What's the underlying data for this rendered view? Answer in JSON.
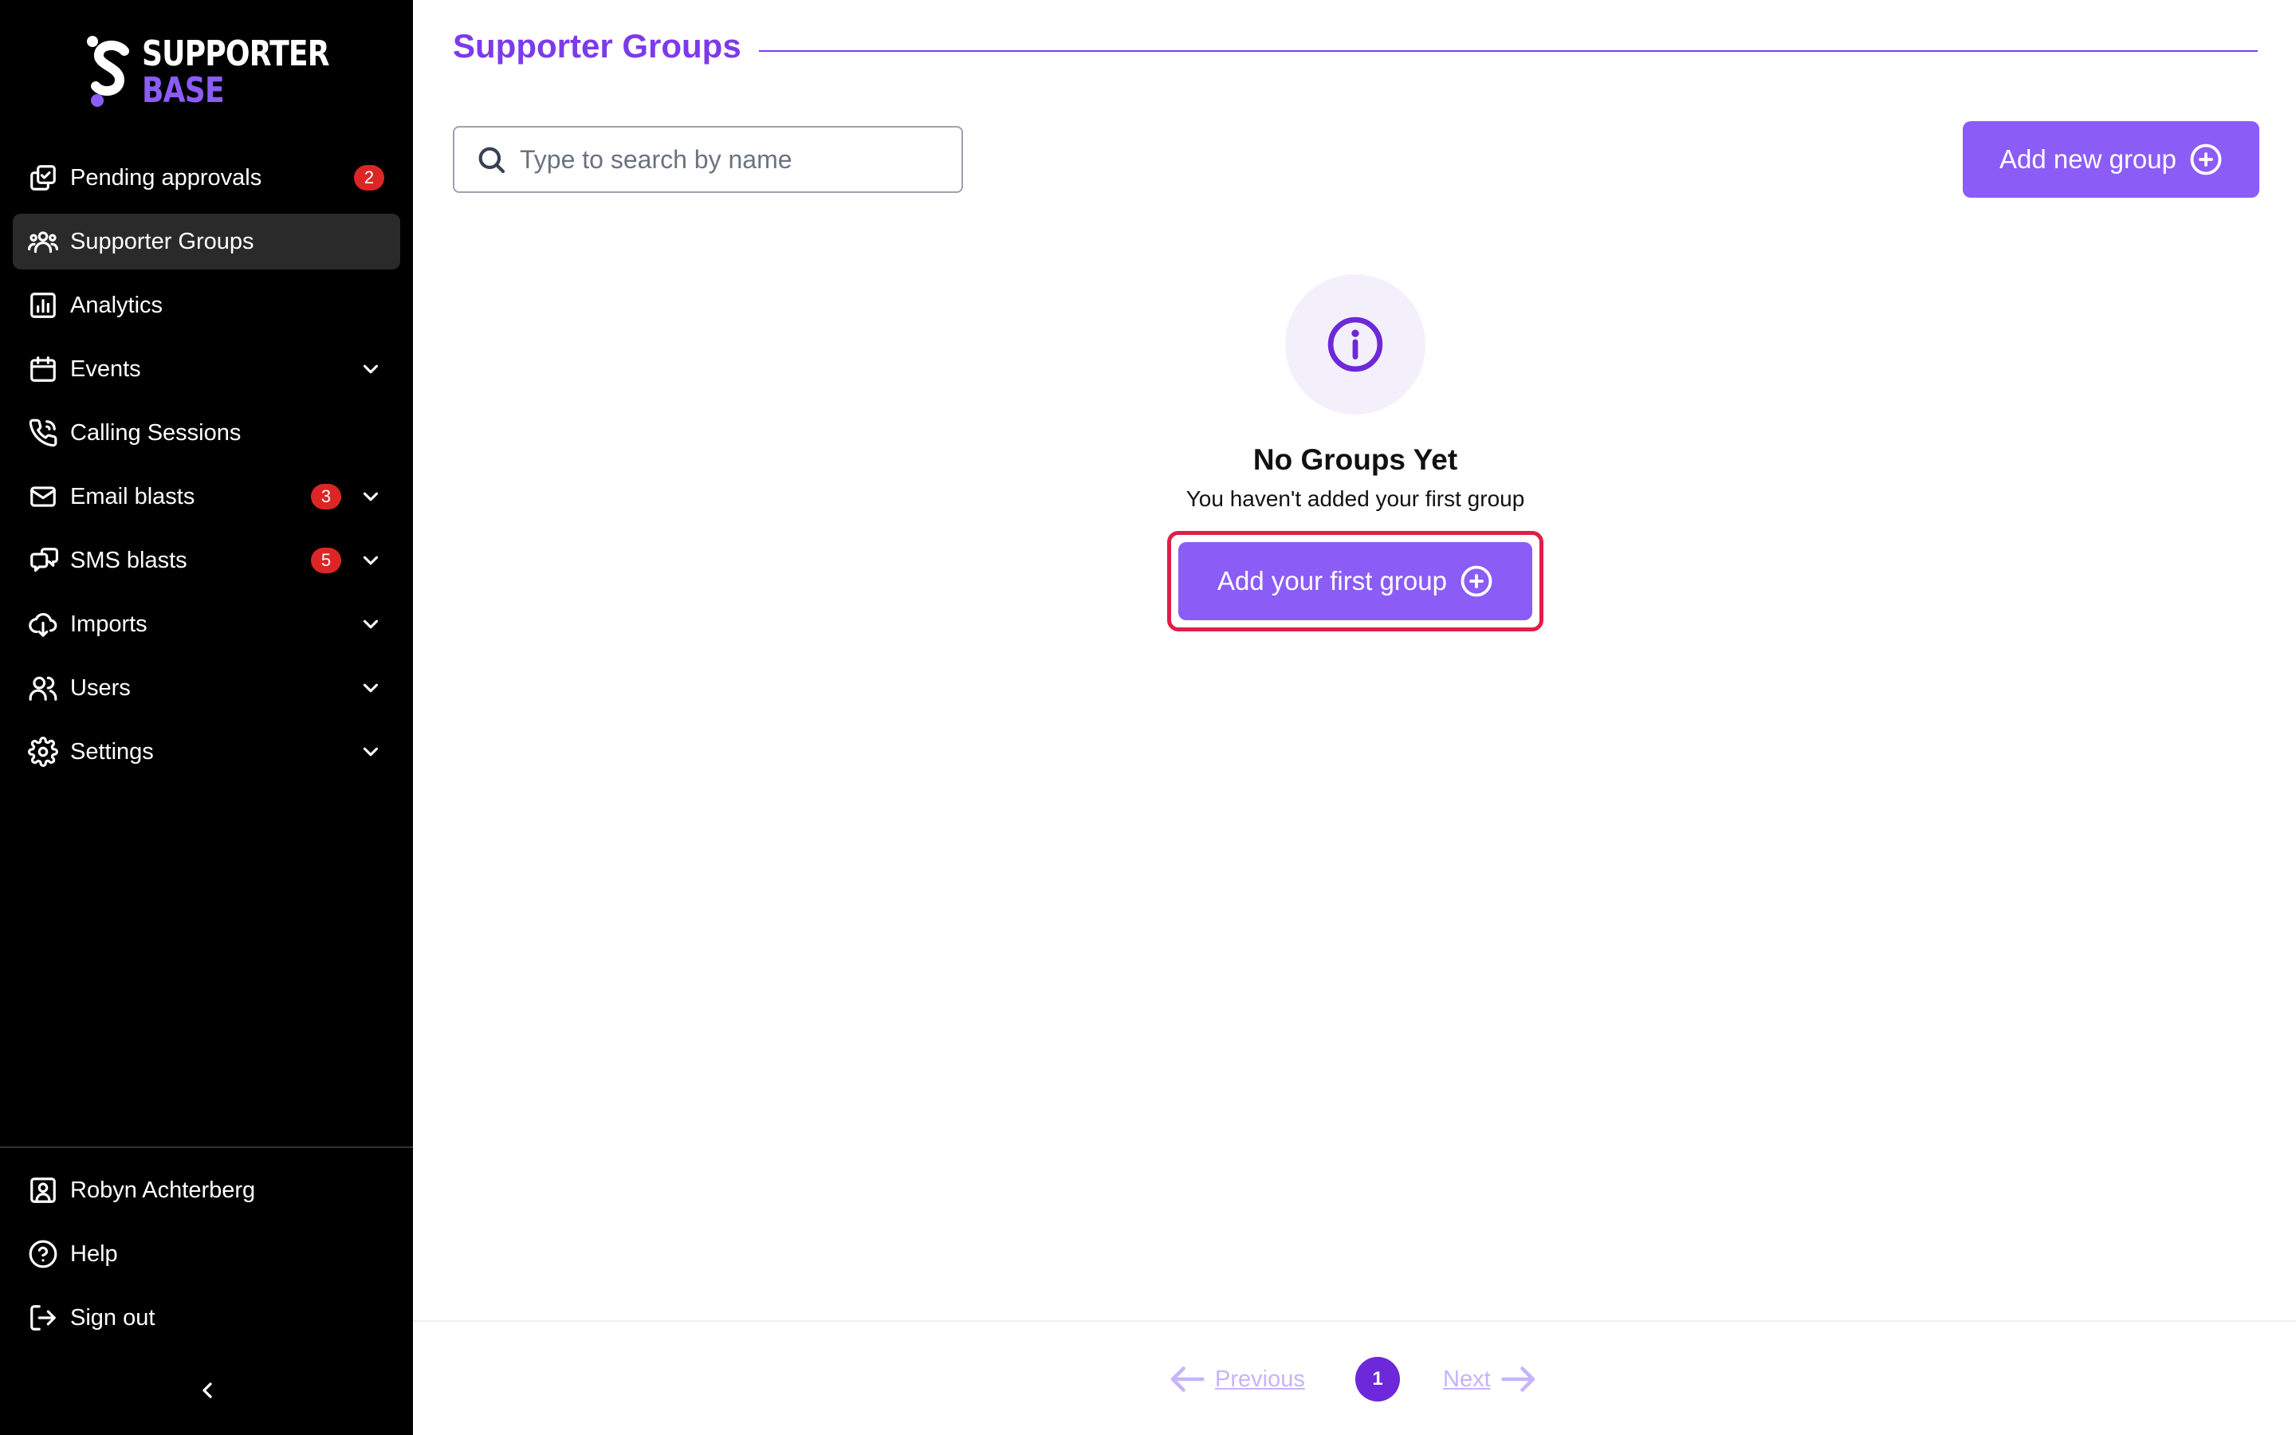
{
  "brand": {
    "line1": "SUPPORTER",
    "line2": "BASE",
    "accent": "#8b5cf6"
  },
  "sidebar": {
    "items": [
      {
        "label": "Pending approvals",
        "icon": "approvals-icon",
        "badge": "2"
      },
      {
        "label": "Supporter Groups",
        "icon": "groups-icon",
        "active": true
      },
      {
        "label": "Analytics",
        "icon": "analytics-icon"
      },
      {
        "label": "Events",
        "icon": "calendar-icon",
        "expandable": true
      },
      {
        "label": "Calling Sessions",
        "icon": "phone-icon"
      },
      {
        "label": "Email blasts",
        "icon": "mail-icon",
        "badge": "3",
        "expandable": true
      },
      {
        "label": "SMS blasts",
        "icon": "sms-icon",
        "badge": "5",
        "expandable": true
      },
      {
        "label": "Imports",
        "icon": "import-icon",
        "expandable": true
      },
      {
        "label": "Users",
        "icon": "users-icon",
        "expandable": true
      },
      {
        "label": "Settings",
        "icon": "gear-icon",
        "expandable": true
      }
    ],
    "bottom": [
      {
        "label": "Robyn Achterberg",
        "icon": "user-profile-icon"
      },
      {
        "label": "Help",
        "icon": "help-icon"
      },
      {
        "label": "Sign out",
        "icon": "sign-out-icon"
      }
    ]
  },
  "main": {
    "title": "Supporter Groups",
    "search": {
      "placeholder": "Type to search by name",
      "value": ""
    },
    "add_new_label": "Add new group",
    "empty": {
      "title": "No Groups Yet",
      "subtitle": "You haven't added your first group",
      "button_label": "Add your first group"
    }
  },
  "pagination": {
    "previous": "Previous",
    "next": "Next",
    "current_page": "1"
  },
  "colors": {
    "primary": "#8b5cf6",
    "title": "#7c3aed",
    "badge": "#dc2626",
    "highlight": "#e11d48"
  }
}
